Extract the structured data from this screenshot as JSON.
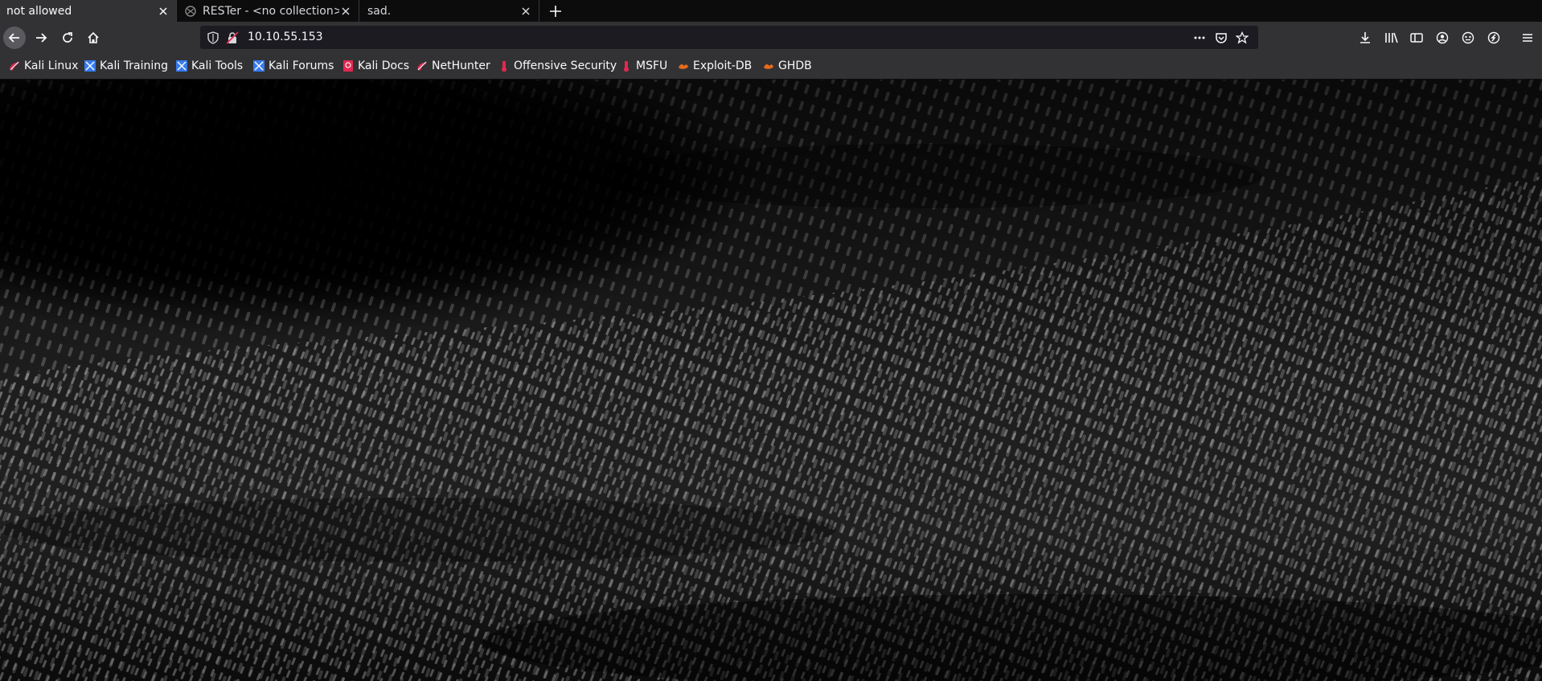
{
  "tabs": [
    {
      "title": "not allowed",
      "active": true
    },
    {
      "title": "RESTer - <no collection>",
      "active": false
    },
    {
      "title": "sad.",
      "active": false
    }
  ],
  "urlbar": {
    "url": "10.10.55.153"
  },
  "bookmarks": [
    {
      "label": "Kali Linux",
      "icon": "kali-linux-icon"
    },
    {
      "label": "Kali Training",
      "icon": "kali-training-icon"
    },
    {
      "label": "Kali Tools",
      "icon": "kali-tools-icon"
    },
    {
      "label": "Kali Forums",
      "icon": "kali-forums-icon"
    },
    {
      "label": "Kali Docs",
      "icon": "kali-docs-icon"
    },
    {
      "label": "NetHunter",
      "icon": "nethunter-icon"
    },
    {
      "label": "Offensive Security",
      "icon": "offensive-security-icon"
    },
    {
      "label": "MSFU",
      "icon": "msfu-icon"
    },
    {
      "label": "Exploit-DB",
      "icon": "exploit-db-icon"
    },
    {
      "label": "GHDB",
      "icon": "ghdb-icon"
    }
  ],
  "colors": {
    "chrome_dark": "#0c0c0d",
    "toolbar": "#323234",
    "urlbar_bg": "#1c1b22",
    "text": "#f9f9fa"
  }
}
